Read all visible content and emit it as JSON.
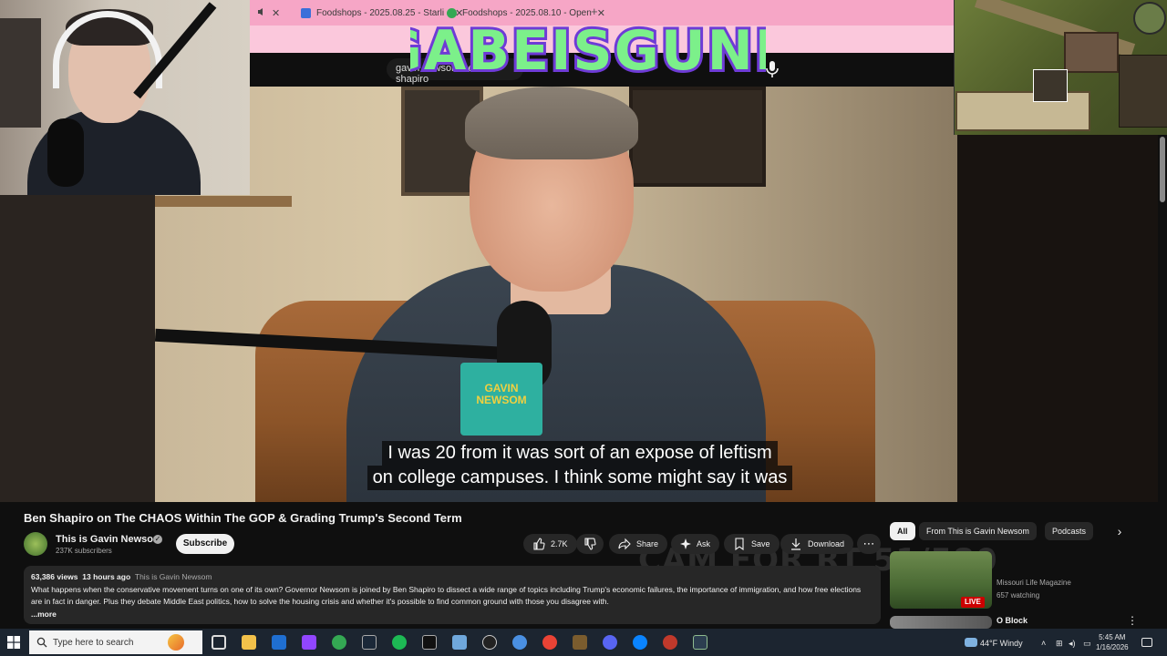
{
  "browser": {
    "tabs": [
      {
        "label": "",
        "favicon_color": "#e74c3c"
      },
      {
        "label": "Foodshops - 2025.08.25 - Starli",
        "favicon_color": "#3b6fd9"
      },
      {
        "label": "Foodshops - 2025.08.10 - Open",
        "favicon_color": "#34a853"
      }
    ],
    "search_value": "gavin newsom ben shapiro"
  },
  "overlay": {
    "logo_text": "GABEISGUNK",
    "watermark_text": "CAM FOR RT 51/580"
  },
  "video": {
    "flag_text": "GAVIN NEWSOM",
    "subtitles": [
      "I was 20 from it was sort of an expose of leftism",
      "on college campuses. I think some might say it was"
    ]
  },
  "watch": {
    "title": "Ben Shapiro on The CHAOS Within The GOP & Grading Trump's Second Term",
    "channel_name": "This is Gavin Newsom",
    "subscribers": "237K subscribers",
    "subscribe_label": "Subscribe",
    "likes": "2.7K",
    "share_label": "Share",
    "ask_label": "Ask",
    "save_label": "Save",
    "download_label": "Download",
    "views": "63,386 views",
    "posted": "13 hours ago",
    "posted_channel": "This is Gavin Newsom",
    "description": "What happens when the conservative movement turns on one of its own? Governor Newsom is joined by Ben Shapiro to dissect a wide range of topics including Trump's economic failures, the importance of immigration, and how free elections are in fact in danger. Plus they debate Middle East politics, how to solve the housing crisis and whether it's possible to find common ground with those you disagree with.",
    "more_label": "...more"
  },
  "sidebar": {
    "chips": [
      "All",
      "From This is Gavin Newsom",
      "Podcasts"
    ],
    "recommendations": [
      {
        "title": "",
        "channel": "Missouri Life Magazine",
        "meta": "657 watching",
        "live_label": "LIVE"
      },
      {
        "title": "O Block",
        "channel": "",
        "meta": ""
      }
    ]
  },
  "taskbar": {
    "search_placeholder": "Type here to search",
    "weather": "44°F  Windy",
    "time": "5:45 AM",
    "date": "1/16/2026"
  },
  "colors": {
    "tabbar_pink": "#f6a6c6",
    "youtube_dark": "#0f0f0f",
    "logo_purple": "#6e3bd6",
    "logo_green": "#7cf08a",
    "live_red": "#cc0000"
  }
}
